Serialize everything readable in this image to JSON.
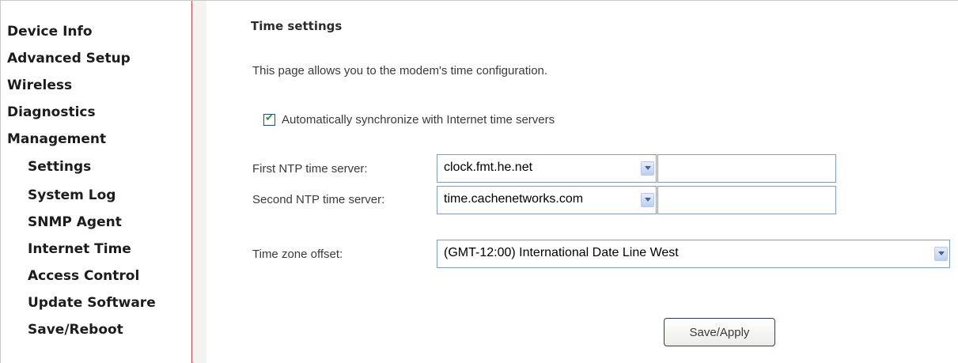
{
  "sidebar": {
    "items": [
      {
        "label": "Device Info"
      },
      {
        "label": "Advanced Setup"
      },
      {
        "label": "Wireless"
      },
      {
        "label": "Diagnostics"
      },
      {
        "label": "Management"
      },
      {
        "label": "Settings"
      },
      {
        "label": "System Log"
      },
      {
        "label": "SNMP Agent"
      },
      {
        "label": "Internet Time"
      },
      {
        "label": "Access Control"
      },
      {
        "label": "Update Software"
      },
      {
        "label": "Save/Reboot"
      }
    ]
  },
  "main": {
    "title": "Time settings",
    "description": "This page allows you to the modem's time configuration.",
    "auto_sync": {
      "label": "Automatically synchronize with Internet time servers",
      "checked": true
    },
    "first_ntp": {
      "label": "First NTP time server:",
      "selected": "clock.fmt.he.net",
      "other_value": ""
    },
    "second_ntp": {
      "label": "Second NTP time server:",
      "selected": "time.cachenetworks.com",
      "other_value": ""
    },
    "timezone": {
      "label": "Time zone offset:",
      "selected": "(GMT-12:00) International Date Line West"
    },
    "save_label": "Save/Apply"
  },
  "colors": {
    "sidebar_border": "#d8424a",
    "select_border": "#7f9db9",
    "button_border": "#2d3c67",
    "checkmark": "#21a121"
  }
}
